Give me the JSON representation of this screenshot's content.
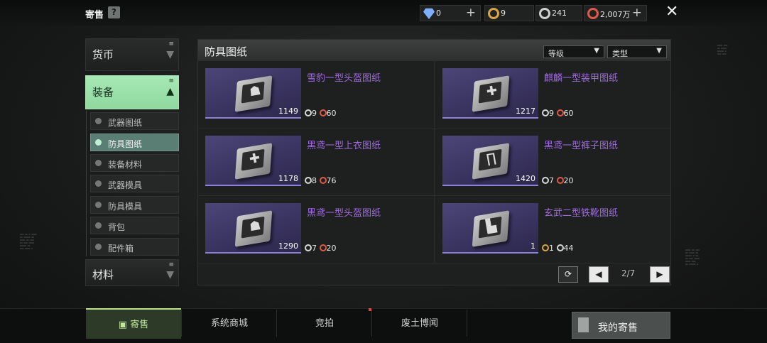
{
  "header": {
    "title": "寄售",
    "help_label": "?",
    "currencies": [
      {
        "icon": "diamond-icon",
        "value": "0",
        "color": "#8fb9ff",
        "has_plus": true
      },
      {
        "icon": "gold-gear-icon",
        "value": "9",
        "color": "#d9a546",
        "has_plus": false
      },
      {
        "icon": "silver-gear-icon",
        "value": "241",
        "color": "#cfcfcf",
        "has_plus": false
      },
      {
        "icon": "red-gear-icon",
        "value": "2,007万",
        "color": "#e05a48",
        "has_plus": true
      }
    ],
    "close_label": "✕"
  },
  "sidebar": {
    "categories": [
      {
        "label": "货币",
        "state": "collapsed"
      },
      {
        "label": "装备",
        "state": "expanded"
      },
      {
        "label": "材料",
        "state": "collapsed"
      }
    ],
    "subitems": [
      {
        "label": "武器图纸",
        "selected": false
      },
      {
        "label": "防具图纸",
        "selected": true
      },
      {
        "label": "装备材料",
        "selected": false
      },
      {
        "label": "武器模具",
        "selected": false
      },
      {
        "label": "防具模具",
        "selected": false
      },
      {
        "label": "背包",
        "selected": false
      },
      {
        "label": "配件箱",
        "selected": false
      }
    ]
  },
  "panel": {
    "title": "防具图纸",
    "filters": [
      {
        "label": "等级"
      },
      {
        "label": "类型"
      }
    ],
    "items": [
      {
        "name": "雪豹一型头盔图纸",
        "qty": "1149",
        "glyph": "☗",
        "stat_a": "9",
        "stat_a_icon": "silver-gear-icon",
        "stat_b": "60",
        "stat_b_icon": "red-gear-icon"
      },
      {
        "name": "麒麟一型装甲图纸",
        "qty": "1217",
        "glyph": "✚",
        "stat_a": "9",
        "stat_a_icon": "silver-gear-icon",
        "stat_b": "60",
        "stat_b_icon": "red-gear-icon"
      },
      {
        "name": "黑鸢一型上衣图纸",
        "qty": "1178",
        "glyph": "✚",
        "stat_a": "8",
        "stat_a_icon": "silver-gear-icon",
        "stat_b": "76",
        "stat_b_icon": "red-gear-icon"
      },
      {
        "name": "黑鸢一型裤子图纸",
        "qty": "1420",
        "glyph": "∏",
        "stat_a": "7",
        "stat_a_icon": "silver-gear-icon",
        "stat_b": "20",
        "stat_b_icon": "red-gear-icon"
      },
      {
        "name": "黑鸢一型头盔图纸",
        "qty": "1290",
        "glyph": "☗",
        "stat_a": "7",
        "stat_a_icon": "silver-gear-icon",
        "stat_b": "20",
        "stat_b_icon": "red-gear-icon"
      },
      {
        "name": "玄武二型铁靴图纸",
        "qty": "1",
        "glyph": "▙",
        "stat_a": "1",
        "stat_a_icon": "gold-gear-icon",
        "stat_b": "44",
        "stat_b_icon": "silver-gear-icon"
      }
    ],
    "pagination": {
      "current_page": "2/7"
    }
  },
  "bottom_nav": {
    "tabs": [
      {
        "label": "寄售",
        "active": true
      },
      {
        "label": "系统商城",
        "active": false
      },
      {
        "label": "竞拍",
        "active": false,
        "badge": true
      },
      {
        "label": "废土博闻",
        "active": false
      }
    ],
    "my_consign_label": "我的寄售"
  }
}
